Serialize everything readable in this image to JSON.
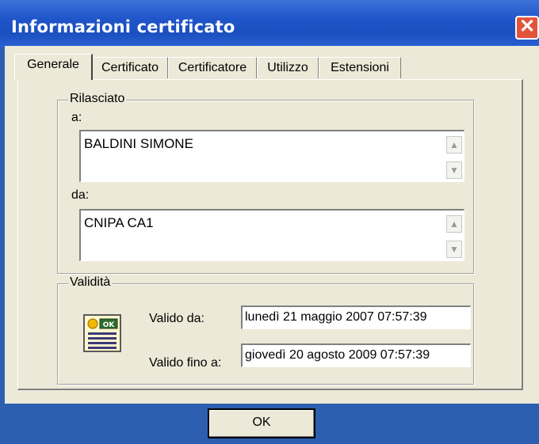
{
  "window": {
    "title": "Informazioni certificato"
  },
  "tabs": [
    {
      "label": "Generale"
    },
    {
      "label": "Certificato"
    },
    {
      "label": "Certificatore"
    },
    {
      "label": "Utilizzo"
    },
    {
      "label": "Estensioni"
    }
  ],
  "issued": {
    "group_label": "Rilasciato",
    "to_label": "a:",
    "to_value": "BALDINI SIMONE",
    "by_label": "da:",
    "by_value": "CNIPA CA1"
  },
  "validity": {
    "group_label": "Validità",
    "from_label": "Valido da:",
    "from_value": "lunedì 21 maggio 2007  07:57:39",
    "until_label": "Valido fino a:",
    "until_value": "giovedì 20 agosto 2009  07:57:39",
    "icon_text": "OK"
  },
  "buttons": {
    "ok": "OK",
    "close": "✕"
  }
}
